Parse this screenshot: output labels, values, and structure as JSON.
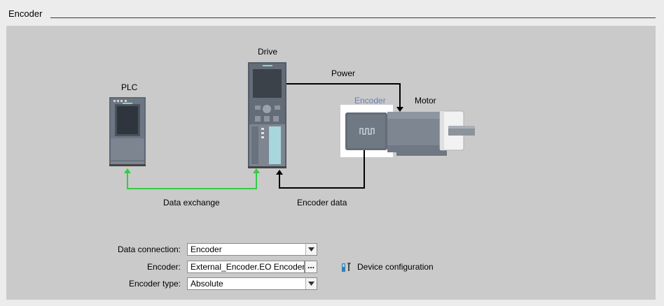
{
  "section": {
    "title": "Encoder"
  },
  "diagram": {
    "plc_label": "PLC",
    "drive_label": "Drive",
    "power_label": "Power",
    "encoder_label": "Encoder",
    "motor_label": "Motor",
    "data_exchange_label": "Data exchange",
    "encoder_data_label": "Encoder data",
    "colors": {
      "data_exchange_line": "#33cc44",
      "encoder_highlight": "#ffffff",
      "encoder_label": "#6a7fb8"
    }
  },
  "form": {
    "data_connection": {
      "label": "Data connection:",
      "value": "Encoder"
    },
    "encoder": {
      "label": "Encoder:",
      "value": "External_Encoder.EO Encoder",
      "browse_label": "..."
    },
    "encoder_type": {
      "label": "Encoder type:",
      "value": "Absolute"
    },
    "device_configuration": {
      "label": "Device configuration",
      "icon": "device-configuration-icon"
    }
  }
}
